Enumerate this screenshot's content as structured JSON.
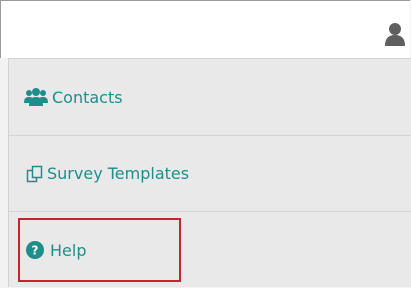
{
  "header": {
    "user_icon": "user-icon"
  },
  "menu": {
    "items": [
      {
        "label": "Contacts",
        "icon": "users-icon"
      },
      {
        "label": "Survey Templates",
        "icon": "copy-icon"
      },
      {
        "label": "Help",
        "icon": "question-circle-icon"
      }
    ],
    "highlighted": "Help"
  },
  "colors": {
    "accent_text": "#1e8e8b",
    "highlight_border": "#c1262e"
  }
}
